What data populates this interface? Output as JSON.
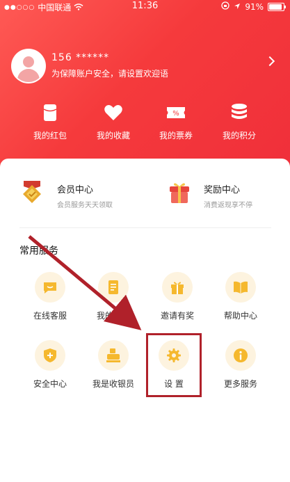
{
  "status_bar": {
    "carrier": "中国联通",
    "time": "11:36",
    "battery": "91%"
  },
  "profile": {
    "phone": "156 ******",
    "tip": "为保障账户安全，请设置欢迎语"
  },
  "quick_entries": [
    {
      "label": "我的红包",
      "icon": "red-packet-icon"
    },
    {
      "label": "我的收藏",
      "icon": "heart-icon"
    },
    {
      "label": "我的票券",
      "icon": "coupon-icon"
    },
    {
      "label": "我的积分",
      "icon": "coins-icon"
    }
  ],
  "features": [
    {
      "title": "会员中心",
      "subtitle": "会员服务天天领取",
      "icon": "member-badge-icon"
    },
    {
      "title": "奖励中心",
      "subtitle": "消费返现享不停",
      "icon": "gift-box-icon"
    }
  ],
  "section_title": "常用服务",
  "services": [
    {
      "label": "在线客服",
      "icon": "chat-icon"
    },
    {
      "label": "我的订单",
      "icon": "order-icon"
    },
    {
      "label": "邀请有奖",
      "icon": "invite-gift-icon"
    },
    {
      "label": "帮助中心",
      "icon": "book-icon"
    },
    {
      "label": "安全中心",
      "icon": "shield-icon"
    },
    {
      "label": "我是收银员",
      "icon": "cashier-icon"
    },
    {
      "label": "设  置",
      "icon": "gear-icon"
    },
    {
      "label": "更多服务",
      "icon": "info-icon"
    }
  ],
  "colors": {
    "header": "#f23a3c",
    "service_icon_bg": "#fdf3df",
    "service_icon": "#f5b82e",
    "annotation": "#b0212a"
  }
}
